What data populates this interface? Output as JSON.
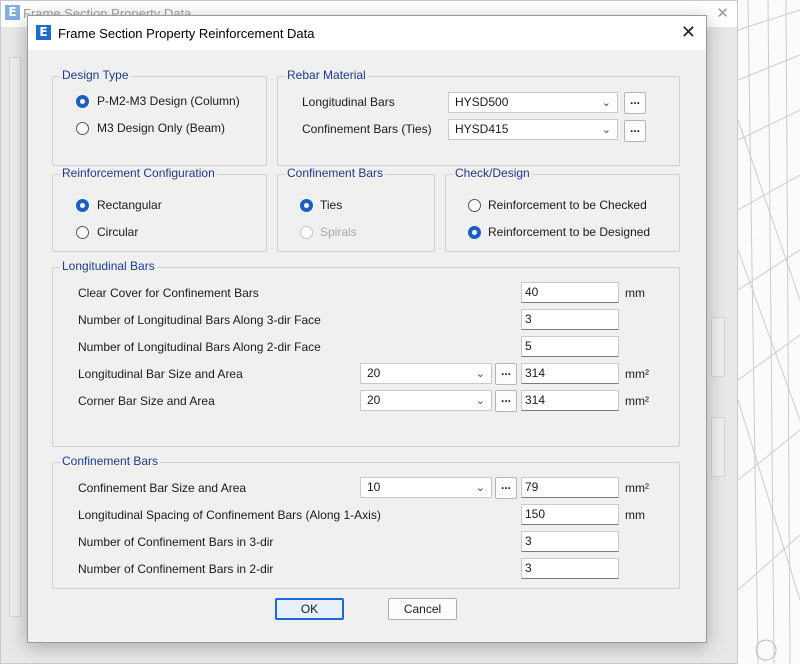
{
  "parent_window": {
    "title": "Frame Section Property Data",
    "app_icon_letter": "E",
    "close_glyph": "✕"
  },
  "dialog": {
    "title": "Frame Section Property Reinforcement Data",
    "app_icon_letter": "E",
    "close_glyph": "✕"
  },
  "design_type": {
    "label": "Design Type",
    "options": [
      {
        "label": "P-M2-M3 Design  (Column)",
        "checked": true
      },
      {
        "label": "M3 Design Only  (Beam)",
        "checked": false
      }
    ]
  },
  "rebar_material": {
    "label": "Rebar Material",
    "longitudinal": {
      "label": "Longitudinal Bars",
      "value": "HYSD500"
    },
    "confinement": {
      "label": "Confinement Bars (Ties)",
      "value": "HYSD415"
    },
    "browse_label": "..."
  },
  "reinforcement_configuration": {
    "label": "Reinforcement Configuration",
    "options": [
      {
        "label": "Rectangular",
        "checked": true
      },
      {
        "label": "Circular",
        "checked": false
      }
    ]
  },
  "confinement_type": {
    "label": "Confinement Bars",
    "options": [
      {
        "label": "Ties",
        "checked": true,
        "enabled": true
      },
      {
        "label": "Spirals",
        "checked": false,
        "enabled": false
      }
    ]
  },
  "check_design": {
    "label": "Check/Design",
    "options": [
      {
        "label": "Reinforcement to be Checked",
        "checked": false
      },
      {
        "label": "Reinforcement to be Designed",
        "checked": true
      }
    ]
  },
  "longitudinal_bars": {
    "label": "Longitudinal Bars",
    "clear_cover": {
      "label": "Clear Cover for Confinement Bars",
      "value": "40",
      "unit": "mm"
    },
    "bars_3dir": {
      "label": "Number of Longitudinal Bars Along 3-dir Face",
      "value": "3"
    },
    "bars_2dir": {
      "label": "Number of Longitudinal Bars Along 2-dir Face",
      "value": "5"
    },
    "bar_size": {
      "label": "Longitudinal Bar Size and Area",
      "size": "20",
      "area": "314",
      "unit": "mm²"
    },
    "corner_size": {
      "label": "Corner Bar Size and Area",
      "size": "20",
      "area": "314",
      "unit": "mm²"
    }
  },
  "confinement_bars": {
    "label": "Confinement Bars",
    "bar_size": {
      "label": "Confinement Bar Size and Area",
      "size": "10",
      "area": "79",
      "unit": "mm²"
    },
    "spacing": {
      "label": "Longitudinal Spacing of Confinement Bars  (Along 1-Axis)",
      "value": "150",
      "unit": "mm"
    },
    "bars_3dir": {
      "label": "Number of Confinement Bars in 3-dir",
      "value": "3"
    },
    "bars_2dir": {
      "label": "Number of Confinement Bars in 2-dir",
      "value": "3"
    }
  },
  "buttons": {
    "ok": "OK",
    "cancel": "Cancel"
  },
  "icons": {
    "dropdown": "chevron-down-icon",
    "close": "close-icon",
    "app": "etabs-app-icon"
  },
  "colors": {
    "accent": "#1b5fbf",
    "group_label": "#1a3c8c",
    "app_icon": "#1e6fc4"
  }
}
